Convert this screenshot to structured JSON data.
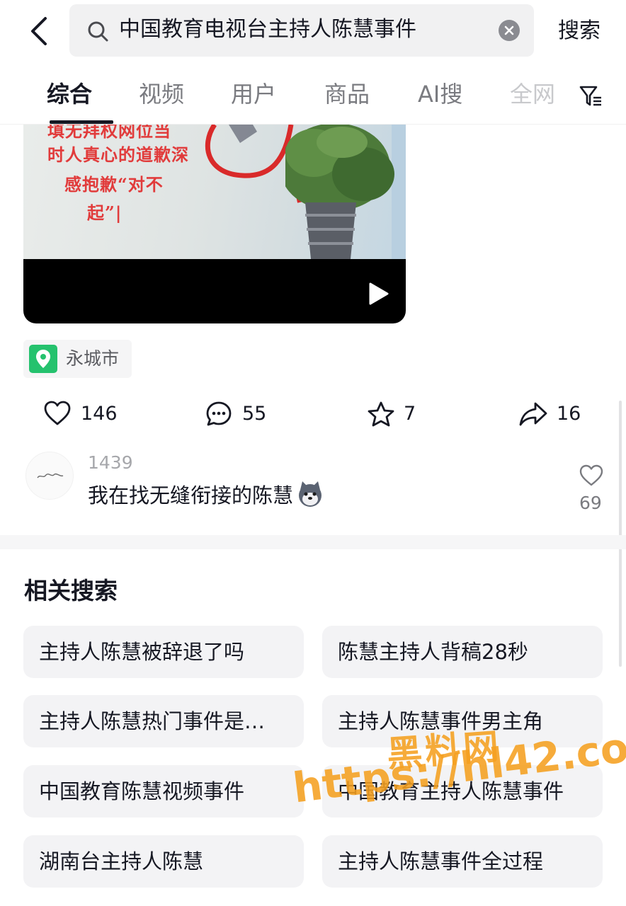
{
  "search": {
    "query": "中国教育电视台主持人陈慧事件",
    "submit_label": "搜索"
  },
  "tabs": [
    {
      "label": "综合"
    },
    {
      "label": "视频"
    },
    {
      "label": "用户"
    },
    {
      "label": "商品"
    },
    {
      "label": "AI搜"
    },
    {
      "label": "全网"
    }
  ],
  "video": {
    "overlay_lines": [
      "填无拜权网位当",
      "时人真心的道歉深",
      "感抱歉“对不",
      "起”|"
    ]
  },
  "location": {
    "label": "永城市"
  },
  "actions": {
    "likes": "146",
    "comments": "55",
    "favorites": "7",
    "shares": "16"
  },
  "comment": {
    "user": "1439",
    "text": "我在找无缝衔接的陈慧",
    "like_count": "69"
  },
  "related": {
    "title": "相关搜索",
    "items": [
      "主持人陈慧被辞退了吗",
      "陈慧主持人背稿28秒",
      "主持人陈慧热门事件是…",
      "主持人陈慧事件男主角",
      "中国教育陈慧视频事件",
      "中国教育主持人陈慧事件",
      "湖南台主持人陈慧",
      "主持人陈慧事件全过程"
    ]
  },
  "watermark": {
    "name": "黑料网",
    "url": "https://hl42.co"
  },
  "colors": {
    "location_icon": "#25c26e",
    "watermark": "#f5a020",
    "overlay_text": "#e13b3b"
  }
}
